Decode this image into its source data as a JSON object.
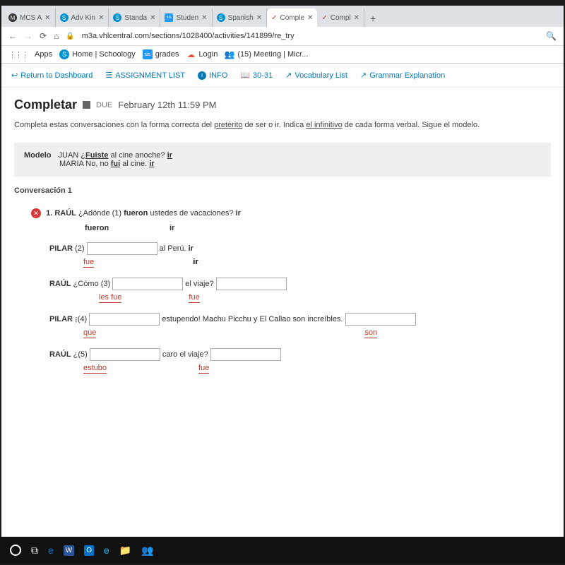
{
  "tabs": [
    {
      "fav": "M",
      "cls": "",
      "label": "MCS A"
    },
    {
      "fav": "S",
      "cls": "s",
      "label": "Adv Kin"
    },
    {
      "fav": "S",
      "cls": "s",
      "label": "Standa"
    },
    {
      "fav": "sis",
      "cls": "sis",
      "label": "Studen"
    },
    {
      "fav": "S",
      "cls": "s",
      "label": "Spanish"
    },
    {
      "fav": "✓",
      "cls": "",
      "label": "Comple",
      "active": true
    },
    {
      "fav": "✓",
      "cls": "",
      "label": "Compl"
    }
  ],
  "url": "m3a.vhlcentral.com/sections/1028400/activities/141899/re_try",
  "bookmarks": {
    "apps": "Apps",
    "home": "Home | Schoology",
    "grades": "grades",
    "login": "Login",
    "meeting": "(15) Meeting | Micr..."
  },
  "nav": {
    "return": "Return to Dashboard",
    "assign": "ASSIGNMENT LIST",
    "info": "INFO",
    "pages": "30-31",
    "vocab": "Vocabulary List",
    "grammar": "Grammar Explanation"
  },
  "title": "Completar",
  "due_label": "DUE",
  "due_date": "February 12th 11:59 PM",
  "instructions_pre": "Completa estas conversaciones con la forma correcta del ",
  "instructions_u1": "pretérito",
  "instructions_mid": " de ser o ir. Indica ",
  "instructions_u2": "el infinitivo",
  "instructions_post": " de cada forma verbal. Sigue el modelo.",
  "modelo": {
    "label": "Modelo",
    "l1a": "JUAN ¿",
    "l1b": "Fuiste",
    "l1c": " al cine anoche? ",
    "l1d": "ir",
    "l2a": "MARIA No, no ",
    "l2b": "fui",
    "l2c": " al cine. ",
    "l2d": "ir"
  },
  "conv_label": "Conversación 1",
  "q1": {
    "num": "1.",
    "speaker": "RAÚL",
    "text1": " ¿Adónde (1)  ",
    "bold": "fueron",
    "text2": "  ustedes de vacaciones?  ",
    "inf": "ir",
    "ans1": "fueron",
    "ans2": "ir"
  },
  "q2": {
    "speaker": "PILAR",
    "pre": " (2) ",
    "post": " al Perú.  ",
    "inf": "ir",
    "corr1": "fue",
    "corr2": "ir"
  },
  "q3": {
    "speaker": "RAÚL",
    "pre": " ¿Cómo (3) ",
    "mid": " el viaje? ",
    "corr1": "les fue",
    "corr2": "fue"
  },
  "q4": {
    "speaker": "PILAR",
    "pre": " ¡(4) ",
    "mid": " estupendo! Machu Picchu y El Callao son increíbles. ",
    "corr1": "que",
    "corr2": "son"
  },
  "q5": {
    "speaker": "RAÚL",
    "pre": " ¿(5) ",
    "mid": " caro el viaje? ",
    "corr1": "estubo",
    "corr2": "fue"
  }
}
